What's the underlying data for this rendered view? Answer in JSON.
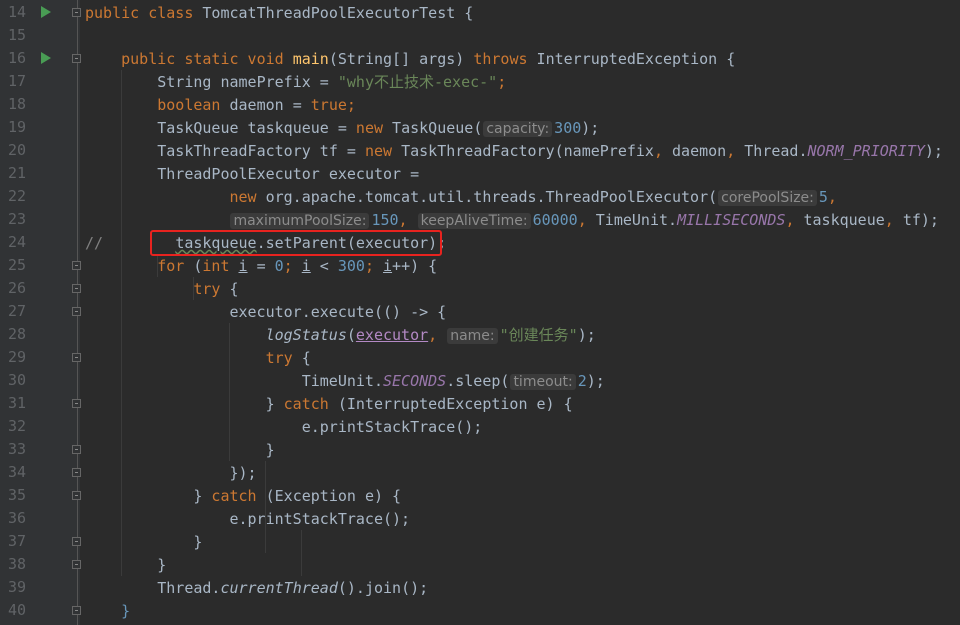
{
  "editor": {
    "colors": {
      "background": "#2B2B2B",
      "gutter": "#313335",
      "keyword": "#CC7832",
      "string": "#6A8759",
      "number": "#6897BB",
      "method_declaration": "#FFC66D",
      "static_field": "#9876AA",
      "highlight_box": "#E8231F"
    },
    "highlighted_line": 24,
    "lines": [
      {
        "n": "14",
        "run": true,
        "fold": "start",
        "indent": 0,
        "t": [
          [
            "public class ",
            "kw"
          ],
          [
            "TomcatThreadPoolExecutorTest {",
            ""
          ]
        ]
      },
      {
        "n": "15",
        "indent": 0,
        "t": []
      },
      {
        "n": "16",
        "run": true,
        "fold": "start",
        "indent": 4,
        "t": [
          [
            "public static void ",
            "kw"
          ],
          [
            "main",
            "fn"
          ],
          [
            "(String[] args) ",
            ""
          ],
          [
            "throws ",
            "kw"
          ],
          [
            "InterruptedException {",
            ""
          ]
        ]
      },
      {
        "n": "17",
        "indent": 8,
        "t": [
          [
            "String namePrefix = ",
            ""
          ],
          [
            "\"why不止技术-exec-\"",
            "str"
          ],
          [
            ";",
            "kw"
          ]
        ]
      },
      {
        "n": "18",
        "indent": 8,
        "t": [
          [
            "boolean ",
            "kw"
          ],
          [
            "daemon = ",
            ""
          ],
          [
            "true",
            "kw"
          ],
          [
            ";",
            "kw"
          ]
        ]
      },
      {
        "n": "19",
        "indent": 8,
        "t": [
          [
            "TaskQueue taskqueue = ",
            ""
          ],
          [
            "new ",
            "kw"
          ],
          [
            "TaskQueue(",
            ""
          ],
          [
            "capacity:",
            "hint"
          ],
          [
            "300",
            "num"
          ],
          [
            ");",
            ""
          ]
        ]
      },
      {
        "n": "20",
        "indent": 8,
        "t": [
          [
            "TaskThreadFactory tf = ",
            ""
          ],
          [
            "new ",
            "kw"
          ],
          [
            "TaskThreadFactory(namePrefix",
            ""
          ],
          [
            ", ",
            "kw"
          ],
          [
            "daemon",
            ""
          ],
          [
            ", ",
            "kw"
          ],
          [
            "Thread.",
            ""
          ],
          [
            "NORM_PRIORITY",
            "st"
          ],
          [
            ");",
            ""
          ]
        ]
      },
      {
        "n": "21",
        "indent": 8,
        "t": [
          [
            "ThreadPoolExecutor executor =",
            ""
          ]
        ]
      },
      {
        "n": "22",
        "indent": 16,
        "t": [
          [
            "new ",
            "kw"
          ],
          [
            "org.apache.tomcat.util.threads.ThreadPoolExecutor(",
            ""
          ],
          [
            "corePoolSize:",
            "hint"
          ],
          [
            "5",
            "num"
          ],
          [
            ",",
            "kw"
          ]
        ]
      },
      {
        "n": "23",
        "indent": 16,
        "t": [
          [
            "maximumPoolSize:",
            "hint"
          ],
          [
            "150",
            "num"
          ],
          [
            ", ",
            "kw"
          ],
          [
            "keepAliveTime:",
            "hint"
          ],
          [
            "60000",
            "num"
          ],
          [
            ", ",
            "kw"
          ],
          [
            "TimeUnit.",
            ""
          ],
          [
            "MILLISECONDS",
            "st"
          ],
          [
            ", ",
            "kw"
          ],
          [
            "taskqueue",
            ""
          ],
          [
            ", ",
            "kw"
          ],
          [
            "tf);",
            ""
          ]
        ]
      },
      {
        "n": "24",
        "indent": 0,
        "t": [
          [
            "//",
            "cm"
          ],
          [
            "        ",
            ""
          ],
          [
            "taskqueue",
            "wavy"
          ],
          [
            ".setParent(executor);",
            ""
          ]
        ]
      },
      {
        "n": "25",
        "fold": "start",
        "indent": 8,
        "t": [
          [
            "for ",
            "kw"
          ],
          [
            "(",
            ""
          ],
          [
            "int ",
            "kw"
          ],
          [
            "i",
            "ul"
          ],
          [
            " = ",
            ""
          ],
          [
            "0",
            "num"
          ],
          [
            "; ",
            "kw"
          ],
          [
            "i",
            "ul"
          ],
          [
            " < ",
            ""
          ],
          [
            "300",
            "num"
          ],
          [
            "; ",
            "kw"
          ],
          [
            "i",
            "ul"
          ],
          [
            "++) {",
            ""
          ]
        ]
      },
      {
        "n": "26",
        "fold": "start",
        "indent": 12,
        "t": [
          [
            "try ",
            "kw"
          ],
          [
            "{",
            ""
          ]
        ]
      },
      {
        "n": "27",
        "fold": "start",
        "indent": 16,
        "t": [
          [
            "executor.execute(() -> {",
            ""
          ]
        ]
      },
      {
        "n": "28",
        "indent": 20,
        "t": [
          [
            "logStatus",
            "it"
          ],
          [
            "(",
            ""
          ],
          [
            "executor",
            "cap"
          ],
          [
            ", ",
            "kw"
          ],
          [
            "name:",
            "hint"
          ],
          [
            "\"创建任务\"",
            "str"
          ],
          [
            ");",
            ""
          ]
        ]
      },
      {
        "n": "29",
        "fold": "start",
        "indent": 20,
        "t": [
          [
            "try ",
            "kw"
          ],
          [
            "{",
            ""
          ]
        ]
      },
      {
        "n": "30",
        "indent": 24,
        "t": [
          [
            "TimeUnit.",
            ""
          ],
          [
            "SECONDS",
            "st"
          ],
          [
            ".sleep(",
            ""
          ],
          [
            "timeout:",
            "hint"
          ],
          [
            "2",
            "num"
          ],
          [
            ");",
            ""
          ]
        ]
      },
      {
        "n": "31",
        "fold": "end",
        "indent": 20,
        "t": [
          [
            "} ",
            ""
          ],
          [
            "catch ",
            "kw"
          ],
          [
            "(InterruptedException e) {",
            ""
          ]
        ]
      },
      {
        "n": "32",
        "indent": 24,
        "t": [
          [
            "e.printStackTrace();",
            ""
          ]
        ]
      },
      {
        "n": "33",
        "fold": "end",
        "indent": 20,
        "t": [
          [
            "}",
            ""
          ]
        ]
      },
      {
        "n": "34",
        "fold": "end",
        "indent": 16,
        "t": [
          [
            "});",
            ""
          ]
        ]
      },
      {
        "n": "35",
        "fold": "start",
        "indent": 12,
        "t": [
          [
            "} ",
            ""
          ],
          [
            "catch ",
            "kw"
          ],
          [
            "(Exception e) {",
            ""
          ]
        ]
      },
      {
        "n": "36",
        "indent": 16,
        "t": [
          [
            "e.printStackTrace();",
            ""
          ]
        ]
      },
      {
        "n": "37",
        "fold": "end",
        "indent": 12,
        "t": [
          [
            "}",
            ""
          ]
        ]
      },
      {
        "n": "38",
        "fold": "end",
        "indent": 8,
        "t": [
          [
            "}",
            ""
          ]
        ]
      },
      {
        "n": "39",
        "indent": 8,
        "t": [
          [
            "Thread.",
            ""
          ],
          [
            "currentThread",
            "it"
          ],
          [
            "().join();",
            ""
          ]
        ]
      },
      {
        "n": "40",
        "fold": "end",
        "indent": 4,
        "t": [
          [
            "}",
            "brace"
          ]
        ]
      }
    ]
  }
}
